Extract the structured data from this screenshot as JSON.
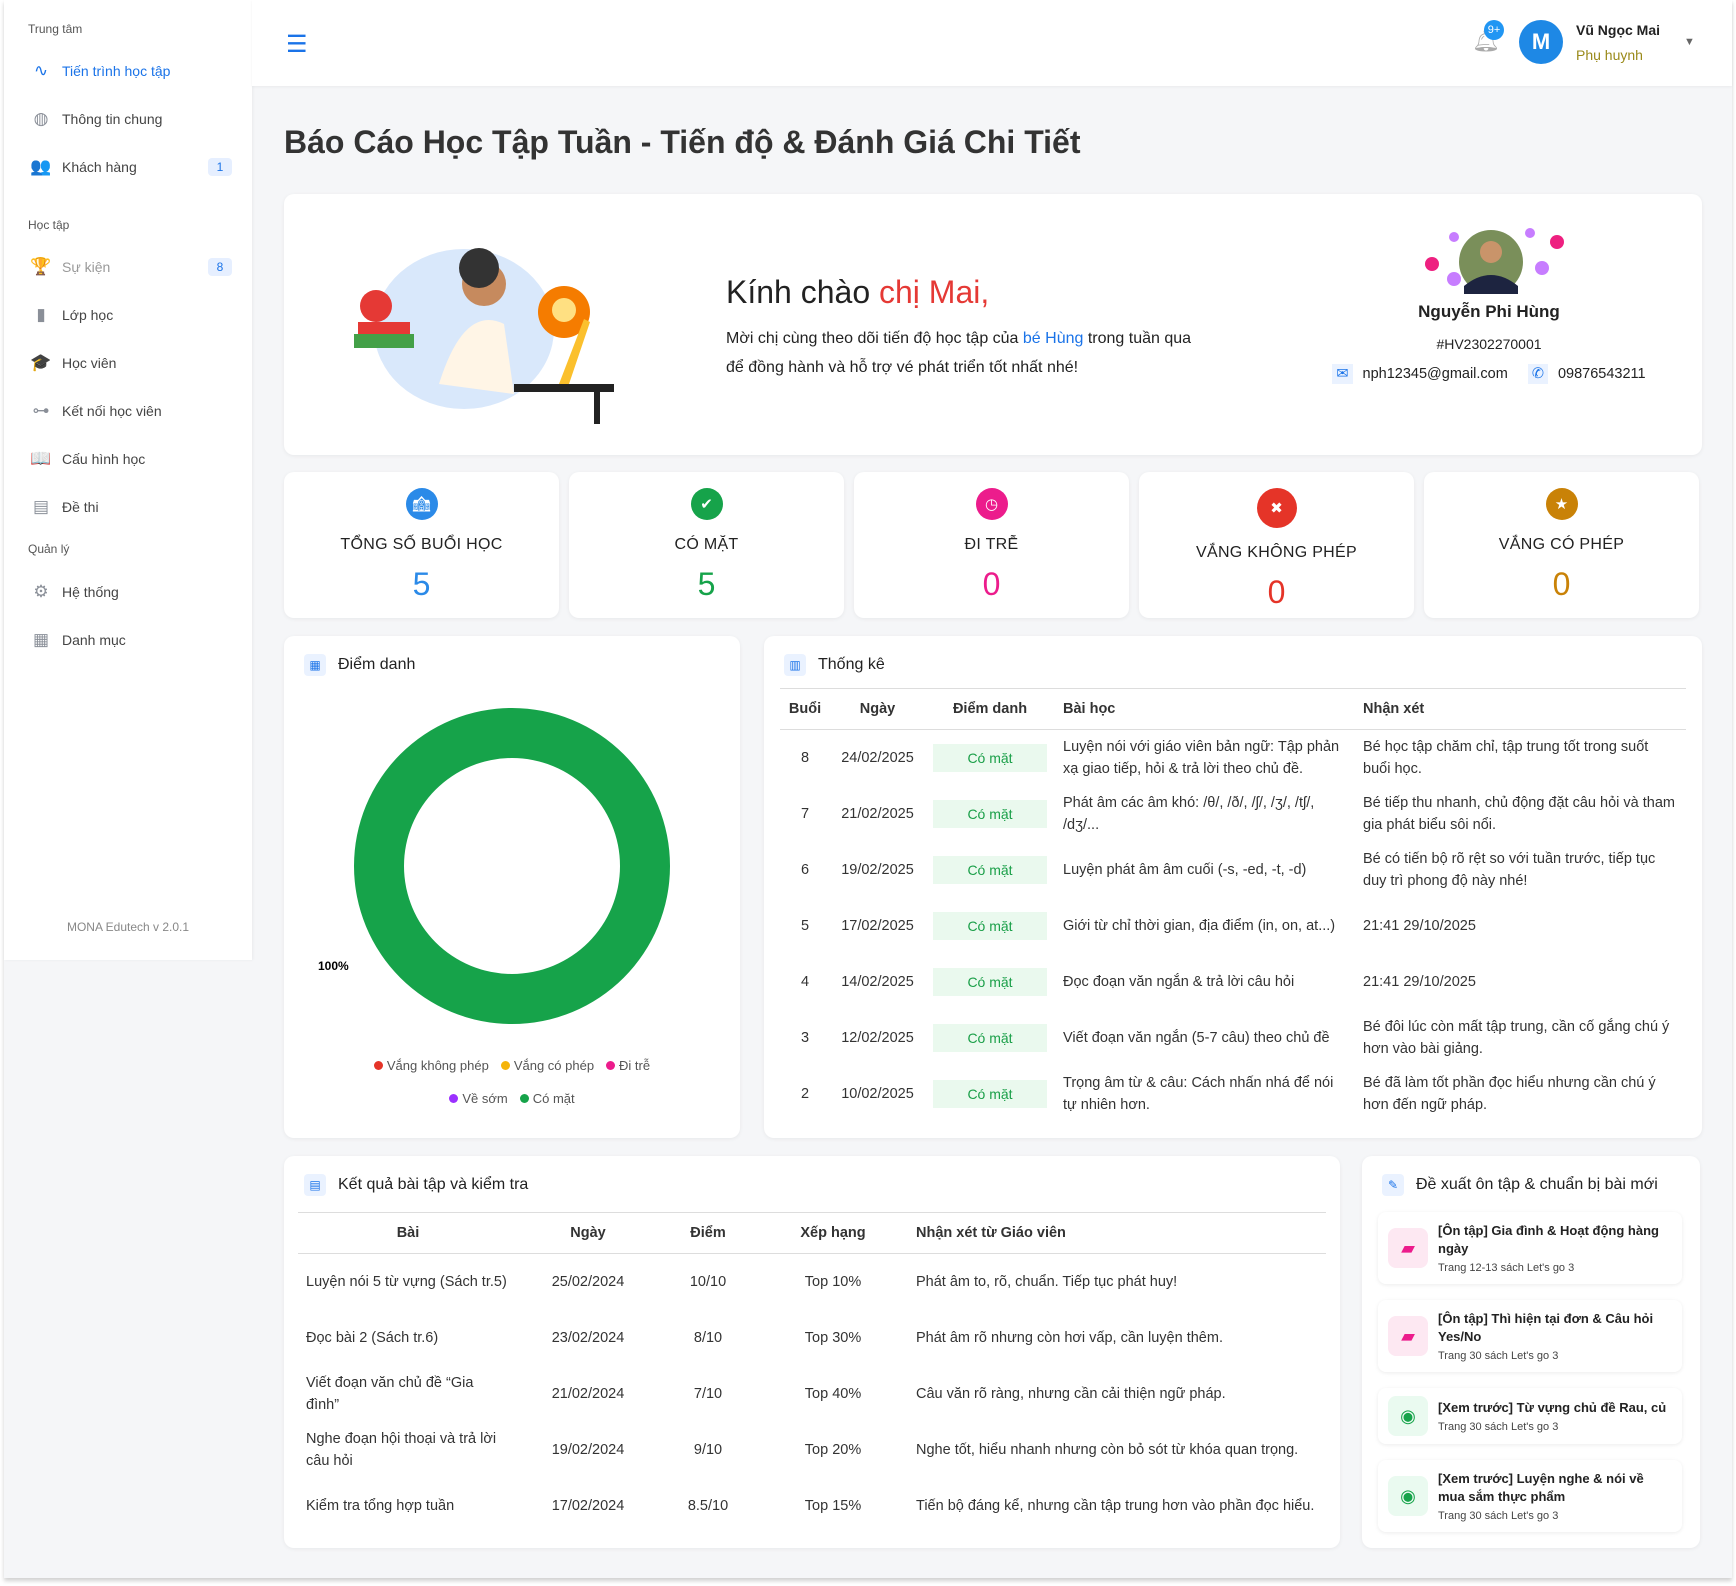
{
  "sidebar": {
    "sections": [
      "Trung tâm",
      "Học tập",
      "Quản lý"
    ],
    "items": [
      {
        "label": "Tiến trình học tập",
        "icon": "activity-icon",
        "active": true
      },
      {
        "label": "Thông tin chung",
        "icon": "globe-icon"
      },
      {
        "label": "Khách hàng",
        "icon": "users-icon",
        "badge": "1"
      },
      {
        "label": "Sự kiện",
        "icon": "trophy-icon",
        "badge": "8"
      },
      {
        "label": "Lớp học",
        "icon": "book-icon"
      },
      {
        "label": "Học viên",
        "icon": "graduation-cap-icon"
      },
      {
        "label": "Kết nối học viên",
        "icon": "connection-icon"
      },
      {
        "label": "Cấu hình học",
        "icon": "open-book-icon"
      },
      {
        "label": "Đề thi",
        "icon": "document-icon"
      },
      {
        "label": "Hệ thống",
        "icon": "gear-icon"
      },
      {
        "label": "Danh mục",
        "icon": "grid-icon"
      }
    ],
    "version": "MONA Edutech v 2.0.1"
  },
  "header": {
    "notif_badge": "9+",
    "avatar_letter": "M",
    "user_name": "Vũ Ngọc Mai",
    "user_role": "Phụ huynh"
  },
  "page_title": "Báo Cáo Học Tập Tuần - Tiến độ & Đánh Giá Chi Tiết",
  "welcome": {
    "greeting": "Kính chào ",
    "name": "chị Mai,",
    "text_1": "Mời chị cùng theo dõi tiến độ học tập của ",
    "child": "bé Hùng",
    "text_2": " trong tuần qua để đồng hành và hỗ trợ vé phát triển tốt nhất nhé!"
  },
  "student": {
    "name": "Nguyễn Phi Hùng",
    "id": "#HV2302270001",
    "email": "nph12345@gmail.com",
    "phone": "09876543211"
  },
  "stats": [
    {
      "label": "TỔNG SỐ BUỔI HỌC",
      "value": "5",
      "color": "#2b8ae8",
      "icon": "school-icon"
    },
    {
      "label": "CÓ MẶT",
      "value": "5",
      "color": "#16a34a",
      "icon": "user-check-icon"
    },
    {
      "label": "ĐI TRỄ",
      "value": "0",
      "color": "#ec1c8c",
      "icon": "clock-icon"
    },
    {
      "label": "VẮNG KHÔNG PHÉP",
      "value": "0",
      "color": "#e53428",
      "icon": "user-x-icon"
    },
    {
      "label": "VẮNG CÓ PHÉP",
      "value": "0",
      "color": "#c98207",
      "icon": "user-badge-icon"
    }
  ],
  "attendance": {
    "title": "Điểm danh",
    "chart_data": {
      "type": "pie",
      "donut": true,
      "labels": [
        "Vắng không phép",
        "Vắng có phép",
        "Đi trễ",
        "Về sớm",
        "Có mặt"
      ],
      "values": [
        0,
        0,
        0,
        0,
        100
      ],
      "colors": [
        "#e53428",
        "#f5b40a",
        "#ec1c8c",
        "#9b30ff",
        "#16a34a"
      ],
      "data_label": "100%",
      "legend": "bottom"
    }
  },
  "stats_table": {
    "title": "Thống kê",
    "headers": [
      "Buổi",
      "Ngày",
      "Điểm danh",
      "Bài học",
      "Nhận xét"
    ],
    "rows": [
      [
        "8",
        "24/02/2025",
        "Có mặt",
        "Luyện nói với giáo viên bản ngữ: Tập phản xạ giao tiếp, hỏi & trả lời theo chủ đề.",
        "Bé học tập chăm chỉ, tập trung tốt trong suốt buổi học."
      ],
      [
        "7",
        "21/02/2025",
        "Có mặt",
        "Phát âm các âm khó: /θ/, /ð/, /ʃ/, /ʒ/, /tʃ/, /dʒ/...",
        "Bé tiếp thu nhanh, chủ động đặt câu hỏi và tham gia phát biểu sôi nổi."
      ],
      [
        "6",
        "19/02/2025",
        "Có mặt",
        "Luyện phát âm âm cuối (-s, -ed, -t, -d)",
        "Bé có tiến bộ rõ rệt so với tuần trước, tiếp tục duy trì phong độ này nhé!"
      ],
      [
        "5",
        "17/02/2025",
        "Có mặt",
        "Giới từ chỉ thời gian, địa điểm (in, on, at...)",
        "21:41 29/10/2025"
      ],
      [
        "4",
        "14/02/2025",
        "Có mặt",
        "Đọc đoạn văn ngắn & trả lời câu hỏi",
        "21:41 29/10/2025"
      ],
      [
        "3",
        "12/02/2025",
        "Có mặt",
        "Viết đoạn văn ngắn (5-7 câu) theo chủ đề",
        "Bé đôi lúc còn mất tập trung, cần cố gắng chú ý hơn vào bài giảng."
      ],
      [
        "2",
        "10/02/2025",
        "Có mặt",
        "Trọng âm từ & câu: Cách nhấn nhá để nói tự nhiên hơn.",
        "Bé đã làm tốt phần đọc hiểu nhưng cần chú ý hơn đến ngữ pháp."
      ]
    ]
  },
  "results": {
    "title": "Kết quả bài tập và kiểm tra",
    "headers": [
      "Bài",
      "Ngày",
      "Điểm",
      "Xếp hạng",
      "Nhận xét từ Giáo viên"
    ],
    "rows": [
      [
        "Luyện nói 5 từ vựng (Sách tr.5)",
        "25/02/2024",
        "10/10",
        "Top 10%",
        "Phát âm to, rõ, chuẩn. Tiếp tục phát huy!"
      ],
      [
        "Đọc bài 2 (Sách tr.6)",
        "23/02/2024",
        "8/10",
        "Top 30%",
        "Phát âm rõ nhưng còn hơi vấp, cần luyện thêm."
      ],
      [
        "Viết đoạn văn chủ đề “Gia đình”",
        "21/02/2024",
        "7/10",
        "Top 40%",
        "Câu văn rõ ràng, nhưng cần cải thiện ngữ pháp."
      ],
      [
        "Nghe đoạn hội thoại và trả lời câu hỏi",
        "19/02/2024",
        "9/10",
        "Top 20%",
        "Nghe tốt, hiểu nhanh nhưng còn bỏ sót từ khóa quan trọng."
      ],
      [
        "Kiểm tra tổng hợp tuần",
        "17/02/2024",
        "8.5/10",
        "Top 15%",
        "Tiến bộ đáng kể, nhưng cần tập trung hơn vào phần đọc hiểu."
      ]
    ]
  },
  "suggestions": {
    "title": "Đề xuất ôn tập & chuẩn bị bài mới",
    "items": [
      {
        "title": "[Ôn tập] Gia đình & Hoạt động hàng ngày",
        "sub": "Trang 12-13 sách Let's go 3",
        "icon": "book-icon"
      },
      {
        "title": "[Ôn tập] Thì hiện tại đơn & Câu hỏi Yes/No",
        "sub": "Trang 30 sách Let's go 3",
        "icon": "book-icon"
      },
      {
        "title": "[Xem trước] Từ vựng chủ đề Rau, củ",
        "sub": "Trang 30 sách Let's go 3",
        "icon": "eye-icon"
      },
      {
        "title": "[Xem trước] Luyện nghe & nói về mua sắm thực phẩm",
        "sub": "Trang 30 sách Let's go 3",
        "icon": "eye-icon"
      }
    ]
  }
}
